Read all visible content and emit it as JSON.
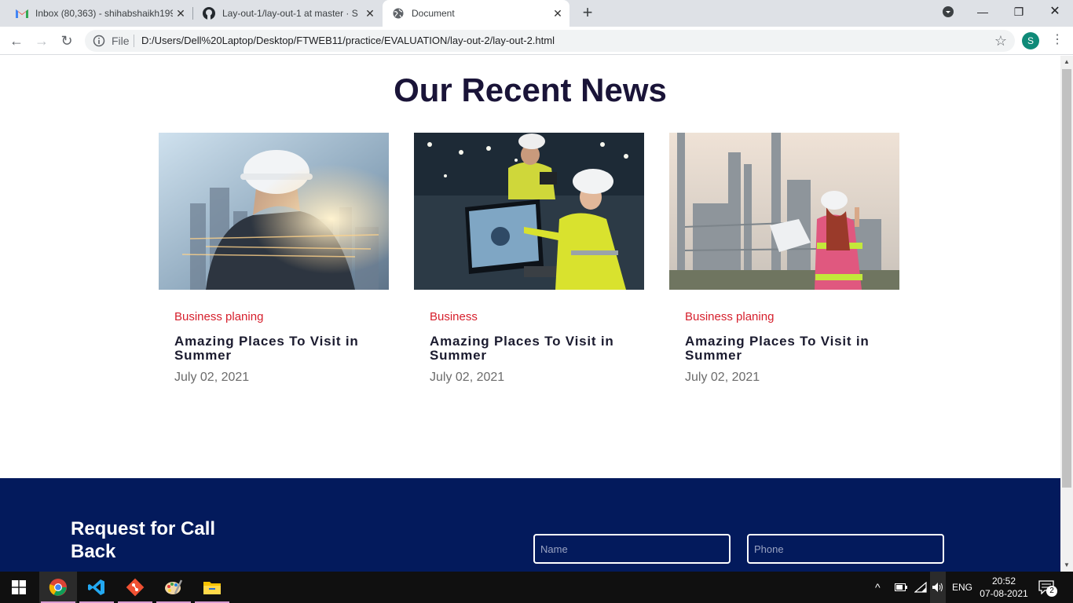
{
  "browser": {
    "tabs": [
      {
        "title": "Inbox (80,363) - shihabshaikh199",
        "icon": "gmail-icon"
      },
      {
        "title": "Lay-out-1/lay-out-1 at master · S",
        "icon": "github-icon"
      },
      {
        "title": "Document",
        "icon": "globe-icon",
        "active": true
      }
    ],
    "scheme_label": "File",
    "url": "D:/Users/Dell%20Laptop/Desktop/FTWEB11/practice/EVALUATION/lay-out-2/lay-out-2.html",
    "profile_initial": "S"
  },
  "page": {
    "title": "Our Recent News",
    "cards": [
      {
        "category": "Business planing",
        "headline": "Amazing Places To Visit in Summer",
        "date": "July 02, 2021",
        "image": "construction-worker-city-photo"
      },
      {
        "category": "Business",
        "headline": "Amazing Places To Visit in Summer",
        "date": "July 02, 2021",
        "image": "engineers-at-computer-photo"
      },
      {
        "category": "Business planing",
        "headline": "Amazing Places To Visit in Summer",
        "date": "July 02, 2021",
        "image": "engineer-at-refinery-photo"
      }
    ],
    "footer": {
      "cta": "Request for Call Back",
      "name_placeholder": "Name",
      "phone_placeholder": "Phone"
    }
  },
  "taskbar": {
    "apps": [
      "chrome-icon",
      "vscode-icon",
      "git-icon",
      "paint-icon",
      "file-explorer-icon"
    ],
    "language": "ENG",
    "time": "20:52",
    "date": "07-08-2021",
    "notifications": "2"
  },
  "colors": {
    "title": "#1a1438",
    "category": "#d61f2c",
    "footer_bg": "#031a5c"
  }
}
